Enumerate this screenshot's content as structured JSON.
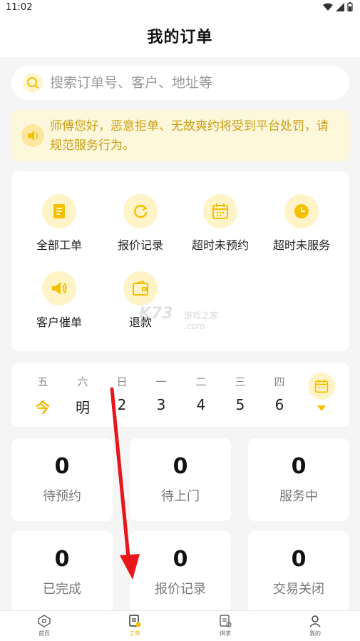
{
  "status_bar": {
    "time": "11:02"
  },
  "header": {
    "title": "我的订单"
  },
  "search": {
    "placeholder": "搜索订单号、客户、地址等"
  },
  "notice": {
    "text": "师傅您好，恶意拒单、无故爽约将受到平台处罚，请规范服务行为。"
  },
  "shortcuts": {
    "all_orders": "全部工单",
    "quote_records": "报价记录",
    "overdue_unbooked": "超时未预约",
    "overdue_unserved": "超时未服务",
    "customer_urge": "客户催单",
    "refund": "退款"
  },
  "watermark": {
    "logo": "K73",
    "site": "游戏之家",
    "domain": ".com"
  },
  "calendar": {
    "days": [
      {
        "weekday": "五",
        "date": "今"
      },
      {
        "weekday": "六",
        "date": "明"
      },
      {
        "weekday": "日",
        "date": "2"
      },
      {
        "weekday": "一",
        "date": "3"
      },
      {
        "weekday": "二",
        "date": "4"
      },
      {
        "weekday": "三",
        "date": "5"
      },
      {
        "weekday": "四",
        "date": "6"
      }
    ]
  },
  "stats": [
    {
      "value": "0",
      "label": "待预约"
    },
    {
      "value": "0",
      "label": "待上门"
    },
    {
      "value": "0",
      "label": "服务中"
    },
    {
      "value": "0",
      "label": "已完成"
    },
    {
      "value": "0",
      "label": "报价记录"
    },
    {
      "value": "0",
      "label": "交易关闭"
    }
  ],
  "tabbar": {
    "home": "首页",
    "work": "工单",
    "supply": "供求",
    "mine": "我的"
  },
  "colors": {
    "accent": "#f5b800",
    "accent_light": "#fff3c8",
    "annotation": "#e8151b"
  }
}
